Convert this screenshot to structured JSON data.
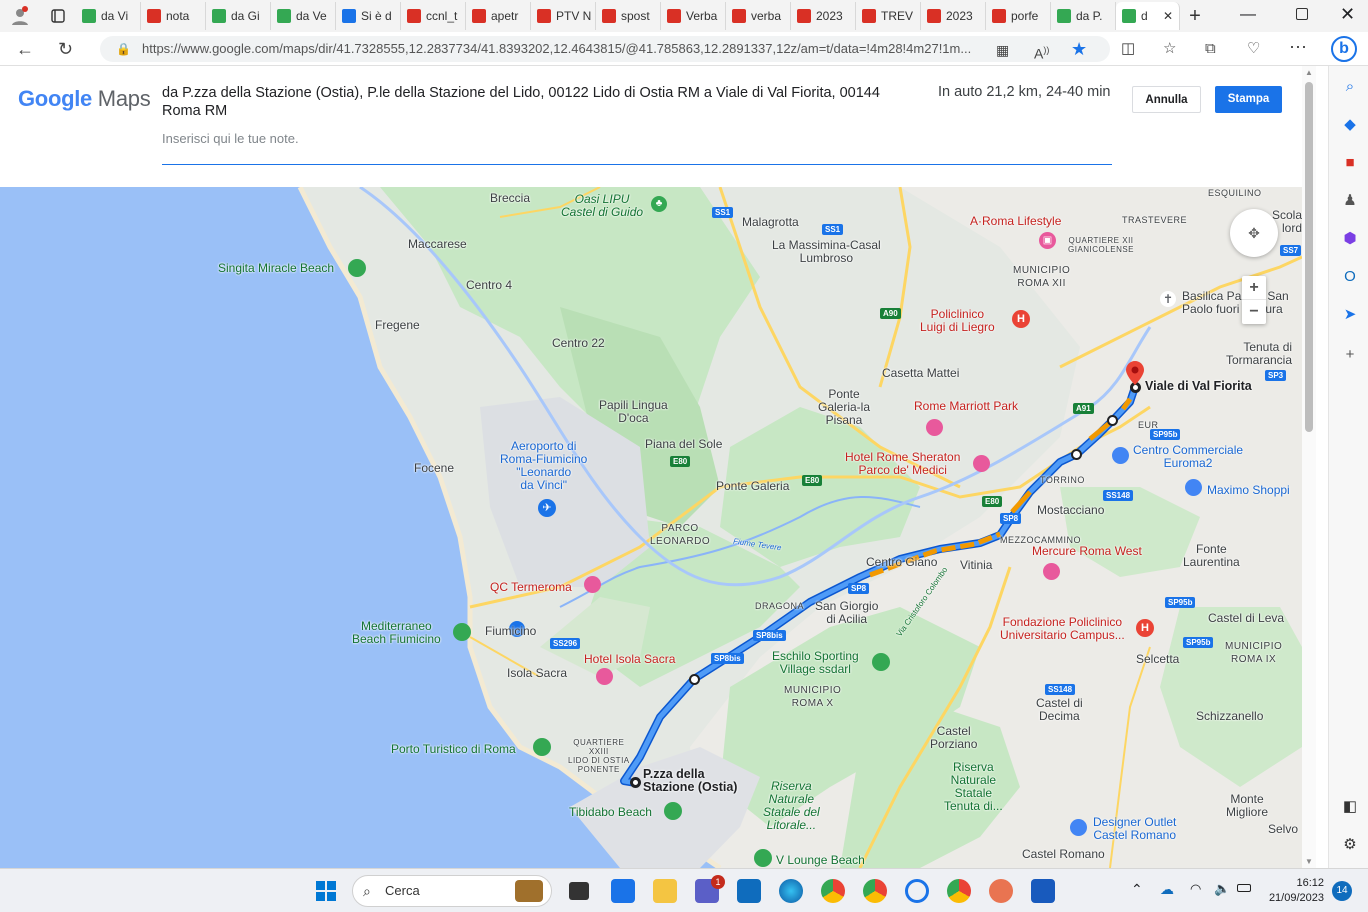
{
  "browser": {
    "tabs": [
      {
        "label": "da Vi",
        "icon": "maps-pin-icon"
      },
      {
        "label": "nota",
        "icon": "pdf-icon"
      },
      {
        "label": "da Gi",
        "icon": "maps-pin-icon"
      },
      {
        "label": "da Ve",
        "icon": "maps-pin-icon"
      },
      {
        "label": "Si è d",
        "icon": "globe-icon"
      },
      {
        "label": "ccnl_t",
        "icon": "pdf-icon"
      },
      {
        "label": "apetr",
        "icon": "pdf-icon"
      },
      {
        "label": "PTV N",
        "icon": "blocked-icon"
      },
      {
        "label": "spost",
        "icon": "pdf-icon"
      },
      {
        "label": "Verba",
        "icon": "pdf-icon"
      },
      {
        "label": "verba",
        "icon": "pdf-icon"
      },
      {
        "label": "2023",
        "icon": "pdf-icon"
      },
      {
        "label": "TREV",
        "icon": "pdf-icon"
      },
      {
        "label": "2023",
        "icon": "pdf-icon"
      },
      {
        "label": "porfe",
        "icon": "pdf-icon"
      },
      {
        "label": "da P.",
        "icon": "maps-pin-icon"
      },
      {
        "label": "d",
        "icon": "maps-pin-icon",
        "active": true
      }
    ],
    "url": "https://www.google.com/maps/dir/41.7328555,12.2837734/41.8393202,12.4643815/@41.785863,12.2891337,12z/am=t/data=!4m28!4m27!1m..."
  },
  "header": {
    "logo_google": "Google",
    "logo_maps": "Maps",
    "directions_text": "da P.zza della Stazione (Ostia), P.le della Stazione del Lido, 00122 Lido di Ostia RM a Viale di Val Fiorita, 00144 Roma RM",
    "duration": "In auto 21,2 km, 24-40 min",
    "notes_placeholder": "Inserisci qui le tue note.",
    "cancel_label": "Annulla",
    "print_label": "Stampa"
  },
  "map": {
    "places": {
      "breccia": "Breccia",
      "oasi": "Oasi LIPU\nCastel di Guido",
      "malagrotta": "Malagrotta",
      "massimina": "La Massimina-Casal\nLumbroso",
      "roma_lifestyle": "A·Roma Lifestyle",
      "trastevere": "TRASTEVERE",
      "esquilino": "ESQUILINO",
      "scola": "Scola\nlord",
      "quartiere_xii": "QUARTIERE XII\nGIANICOLENSE",
      "municipio_xii": "MUNICIPIO\nROMA XII",
      "maccarese": "Maccarese",
      "singita": "Singita Miracle Beach",
      "centro4": "Centro 4",
      "fregene": "Fregene",
      "centro22": "Centro 22",
      "policlinico": "Policlinico\nLuigi di Liegro",
      "basilica": "Basilica Papale San\nPaolo fuori le Mura",
      "tenuta": "Tenuta di\nTormarancia",
      "casetta": "Casetta Mattei",
      "papili": "Papili Lingua\nD'oca",
      "ponte_galeria_pisana": "Ponte\nGaleria-la\nPisana",
      "marriott": "Rome Marriott Park",
      "viale_val_fiorita": "Viale di Val Fiorita",
      "eur": "EUR",
      "piana_sole": "Piana del Sole",
      "aeroporto": "Aeroporto di\nRoma-Fiumicino\n\"Leonardo\nda Vinci\"",
      "sheraton": "Hotel Rome Sheraton\nParco de' Medici",
      "centro_commerciale": "Centro Commerciale\nEuroma2",
      "focene": "Focene",
      "torrino": "TORRINO",
      "ponte_galeria": "Ponte Galeria",
      "maximo": "Maximo Shoppi",
      "mostacciano": "Mostacciano",
      "parco_leonardo": "PARCO\nLEONARDO",
      "fiume_tevere": "Fiume Tevere",
      "mezzocammino": "MEZZOCAMMINO",
      "fonte_laurentina": "Fonte\nLaurentina",
      "centro_giano": "Centro Giano",
      "vitinia": "Vitinia",
      "mercure": "Mercure Roma West",
      "qc_termeroma": "QC Termeroma",
      "dragona": "DRAGONA",
      "san_giorgio": "San Giorgio\ndi Acilia",
      "castel_leva": "Castel di Leva",
      "mediterraneo": "Mediterraneo\nBeach Fiumicino",
      "fiumicino": "Fiumicino",
      "fondazione": "Fondazione Policlinico\nUniversitario Campus...",
      "municipio_ix": "MUNICIPIO\nROMA IX",
      "isola_sacra": "Isola Sacra",
      "hotel_isola": "Hotel Isola Sacra",
      "eschilo": "Eschilo Sporting\nVillage ssdarl",
      "selcetta": "Selcetta",
      "municipio_x": "MUNICIPIO\nROMA X",
      "castel_decima": "Castel di\nDecima",
      "schizzanello": "Schizzanello",
      "castel_porziano": "Castel\nPorziano",
      "porto_turistico": "Porto Turistico di Roma",
      "quartiere_xxiii": "QUARTIERE\nXXIII\nLIDO DI OSTIA\nPONENTE",
      "pzza_stazione": "P.zza della\nStazione (Ostia)",
      "riserva_litorale": "Riserva\nNaturale\nStatale del\nLitorale...",
      "riserva_tenuta": "Riserva\nNaturale\nStatale\nTenuta di...",
      "tibidabo": "Tibidabo Beach",
      "monte_migliore": "Monte\nMigliore",
      "designer_outlet": "Designer Outlet\nCastel Romano",
      "selvo": "Selvo",
      "v_lounge": "V Lounge Beach",
      "castel_romano": "Castel Romano",
      "via_cristoforo": "Via Cristoforo Colombo"
    },
    "roads": {
      "ss1a": "SS1",
      "ss1b": "SS1",
      "a90": "A90",
      "a91": "A91",
      "e80a": "E80",
      "e80b": "E80",
      "e80c": "E80",
      "sp3": "SP3",
      "ss7": "SS7",
      "sp95b": "SP95b",
      "ss148a": "SS148",
      "ss148b": "SS148",
      "sp8": "SP8",
      "sp8b": "SP8",
      "sp8bis_a": "SP8bis",
      "sp8bis_b": "SP8bis",
      "ss296": "SS296",
      "sp95b2": "SP95b",
      "sp95b3": "SP95b"
    },
    "controls": {
      "zoom_in": "+",
      "zoom_out": "−"
    }
  },
  "taskbar": {
    "search_label": "Cerca",
    "time": "16:12",
    "date": "21/09/2023",
    "notification_count": "14",
    "teams_badge": "1"
  },
  "colors": {
    "water": "#9ac0f7",
    "route": "#1a73e8",
    "traffic": "#f29900",
    "park": "#c7e7c4",
    "accent": "#1a73e8"
  }
}
